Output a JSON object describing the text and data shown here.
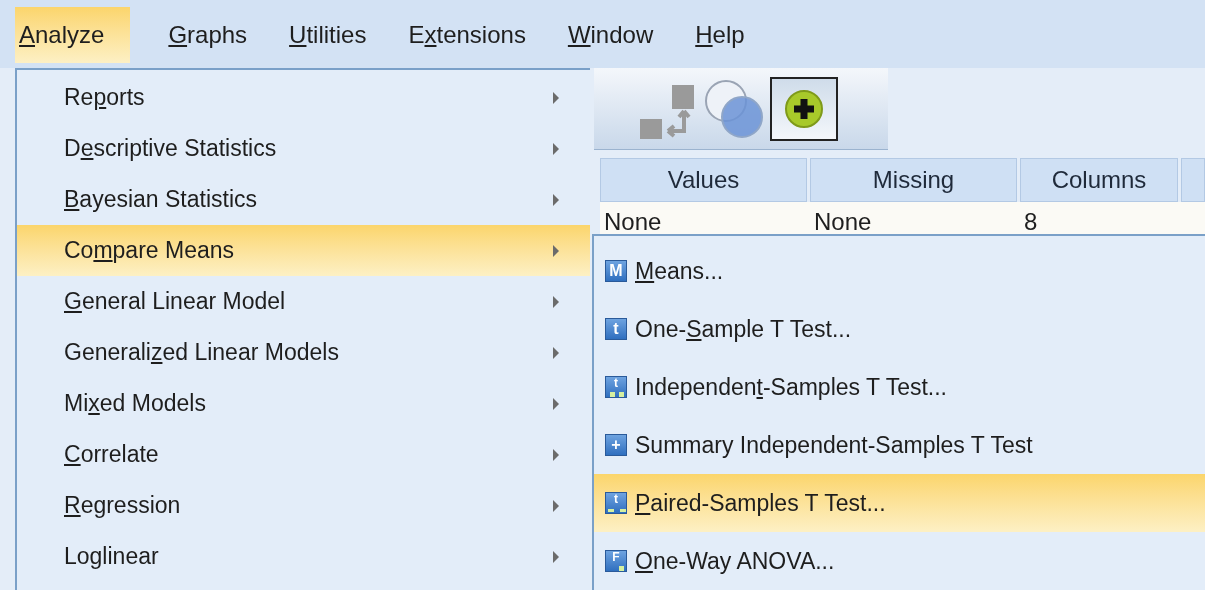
{
  "menu_bar": [
    {
      "key": "A",
      "post": "nalyze",
      "selected": true
    },
    {
      "key": "G",
      "post": "raphs",
      "selected": false
    },
    {
      "key": "U",
      "post": "tilities",
      "selected": false
    },
    {
      "pre": "E",
      "key": "x",
      "post": "tensions",
      "selected": false
    },
    {
      "key": "W",
      "post": "indow",
      "selected": false
    },
    {
      "key": "H",
      "post": "elp",
      "selected": false
    }
  ],
  "toolbar": [
    {
      "kind": "relabel",
      "selected": false
    },
    {
      "kind": "venn",
      "selected": false
    },
    {
      "kind": "add",
      "selected": true
    }
  ],
  "table": {
    "columns": [
      "Values",
      "Missing",
      "Columns"
    ],
    "rows": [
      [
        "None",
        "None",
        "8"
      ]
    ]
  },
  "analyze_menu": [
    {
      "pre": "Re",
      "key": "p",
      "post": "orts",
      "selected": false
    },
    {
      "pre": "D",
      "key": "e",
      "post": "scriptive Statistics",
      "selected": false
    },
    {
      "key": "B",
      "post": "ayesian Statistics",
      "selected": false
    },
    {
      "pre": "Co",
      "key": "m",
      "post": "pare Means",
      "selected": true
    },
    {
      "key": "G",
      "post": "eneral Linear Model",
      "selected": false
    },
    {
      "pre": "Generali",
      "key": "z",
      "post": "ed Linear Models",
      "selected": false
    },
    {
      "pre": "Mi",
      "key": "x",
      "post": "ed Models",
      "selected": false
    },
    {
      "key": "C",
      "post": "orrelate",
      "selected": false
    },
    {
      "key": "R",
      "post": "egression",
      "selected": false
    },
    {
      "pre": "Loglinear",
      "selected": false
    }
  ],
  "compare_means_menu": [
    {
      "icon": "M",
      "kind": "letter",
      "key": "M",
      "post": "eans...",
      "selected": false
    },
    {
      "icon": "t",
      "kind": "letter",
      "pre": "One-",
      "key": "S",
      "post": "ample T Test...",
      "selected": false
    },
    {
      "icon": "t",
      "kind": "ab",
      "pre": "Independen",
      "key": "t",
      "post": "-Samples T Test...",
      "selected": false
    },
    {
      "icon": "+",
      "kind": "letter",
      "pre": "Summary Independent-Samples T Test",
      "selected": false
    },
    {
      "icon": "t",
      "kind": "paired",
      "key": "P",
      "post": "aired-Samples T Test...",
      "selected": true
    },
    {
      "icon": "F",
      "kind": "anova",
      "key": "O",
      "post": "ne-Way ANOVA...",
      "selected": false
    }
  ]
}
